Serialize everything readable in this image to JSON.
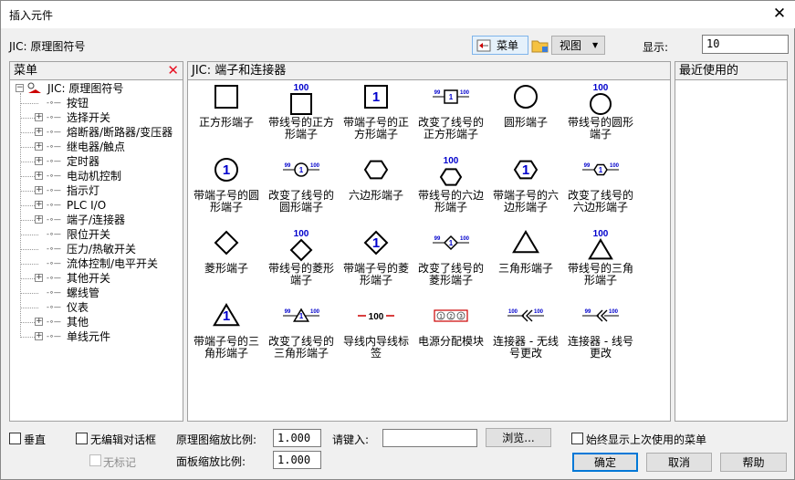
{
  "window": {
    "title": "插入元件"
  },
  "header": {
    "library_label": "JIC: 原理图符号",
    "menu_button": "菜单",
    "view_button": "视图",
    "display_label": "显示:",
    "display_value": "10"
  },
  "tree_panel": {
    "title": "菜单",
    "root": "JIC: 原理图符号",
    "items": [
      {
        "label": "按钮",
        "expandable": false
      },
      {
        "label": "选择开关",
        "expandable": true
      },
      {
        "label": "熔断器/断路器/变压器",
        "expandable": true
      },
      {
        "label": "继电器/触点",
        "expandable": true
      },
      {
        "label": "定时器",
        "expandable": true
      },
      {
        "label": "电动机控制",
        "expandable": true
      },
      {
        "label": "指示灯",
        "expandable": true
      },
      {
        "label": "PLC I/O",
        "expandable": true
      },
      {
        "label": "端子/连接器",
        "expandable": true
      },
      {
        "label": "限位开关",
        "expandable": false
      },
      {
        "label": "压力/热敏开关",
        "expandable": false
      },
      {
        "label": "流体控制/电平开关",
        "expandable": false
      },
      {
        "label": "其他开关",
        "expandable": true
      },
      {
        "label": "螺线管",
        "expandable": false
      },
      {
        "label": "仪表",
        "expandable": false
      },
      {
        "label": "其他",
        "expandable": true
      },
      {
        "label": "单线元件",
        "expandable": true
      }
    ]
  },
  "symbol_panel": {
    "title": "JIC: 端子和连接器",
    "symbols": [
      {
        "label": "正方形端子",
        "shape": "square",
        "variant": "plain"
      },
      {
        "label": "带线号的正方形端子",
        "shape": "square",
        "variant": "wire",
        "tag": "100"
      },
      {
        "label": "带端子号的正方形端子",
        "shape": "square",
        "variant": "term",
        "tag": "1"
      },
      {
        "label": "改变了线号的正方形端子",
        "shape": "square",
        "variant": "change",
        "tag": "1",
        "left": "99",
        "right": "100"
      },
      {
        "label": "圆形端子",
        "shape": "circle",
        "variant": "plain"
      },
      {
        "label": "带线号的圆形端子",
        "shape": "circle",
        "variant": "wire",
        "tag": "100"
      },
      {
        "label": "带端子号的圆形端子",
        "shape": "circle",
        "variant": "term",
        "tag": "1"
      },
      {
        "label": "改变了线号的圆形端子",
        "shape": "circle",
        "variant": "change",
        "tag": "1",
        "left": "99",
        "right": "100"
      },
      {
        "label": "六边形端子",
        "shape": "hexagon",
        "variant": "plain"
      },
      {
        "label": "带线号的六边形端子",
        "shape": "hexagon",
        "variant": "wire",
        "tag": "100"
      },
      {
        "label": "带端子号的六边形端子",
        "shape": "hexagon",
        "variant": "term",
        "tag": "1"
      },
      {
        "label": "改变了线号的六边形端子",
        "shape": "hexagon",
        "variant": "change",
        "tag": "1",
        "left": "99",
        "right": "100"
      },
      {
        "label": "菱形端子",
        "shape": "diamond",
        "variant": "plain"
      },
      {
        "label": "带线号的菱形端子",
        "shape": "diamond",
        "variant": "wire",
        "tag": "100"
      },
      {
        "label": "带端子号的菱形端子",
        "shape": "diamond",
        "variant": "term",
        "tag": "1"
      },
      {
        "label": "改变了线号的菱形端子",
        "shape": "diamond",
        "variant": "change",
        "tag": "1",
        "left": "99",
        "right": "100"
      },
      {
        "label": "三角形端子",
        "shape": "triangle",
        "variant": "plain"
      },
      {
        "label": "带线号的三角形端子",
        "shape": "triangle",
        "variant": "wire",
        "tag": "100"
      },
      {
        "label": "带端子号的三角形端子",
        "shape": "triangle",
        "variant": "term",
        "tag": "1"
      },
      {
        "label": "改变了线号的三角形端子",
        "shape": "triangle",
        "variant": "change",
        "tag": "1",
        "left": "99",
        "right": "100"
      },
      {
        "label": "导线内导线标签",
        "shape": "inline",
        "variant": "plain",
        "tag": "100"
      },
      {
        "label": "电源分配模块",
        "shape": "block",
        "variant": "plain",
        "tags": [
          "1",
          "2",
          "3"
        ]
      },
      {
        "label": "连接器 - 无线号更改",
        "shape": "connector",
        "variant": "plain",
        "left": "100",
        "right": "100"
      },
      {
        "label": "连接器 - 线号更改",
        "shape": "connector",
        "variant": "change",
        "left": "99",
        "right": "100"
      }
    ]
  },
  "recent_panel": {
    "title": "最近使用的"
  },
  "footer": {
    "vertical_label": "垂直",
    "no_edit_label": "无编辑对话框",
    "no_tag_label": "无标记",
    "schematic_scale_label": "原理图缩放比例:",
    "schematic_scale_value": "1.000",
    "panel_scale_label": "面板缩放比例:",
    "panel_scale_value": "1.000",
    "enter_label": "请键入:",
    "enter_value": "",
    "browse_button": "浏览...",
    "always_show_label": "始终显示上次使用的菜单",
    "ok_button": "确定",
    "cancel_button": "取消",
    "help_button": "帮助"
  },
  "colors": {
    "accent": "#0000cc",
    "close_red": "#e81123",
    "button_blue": "#0078d7"
  }
}
